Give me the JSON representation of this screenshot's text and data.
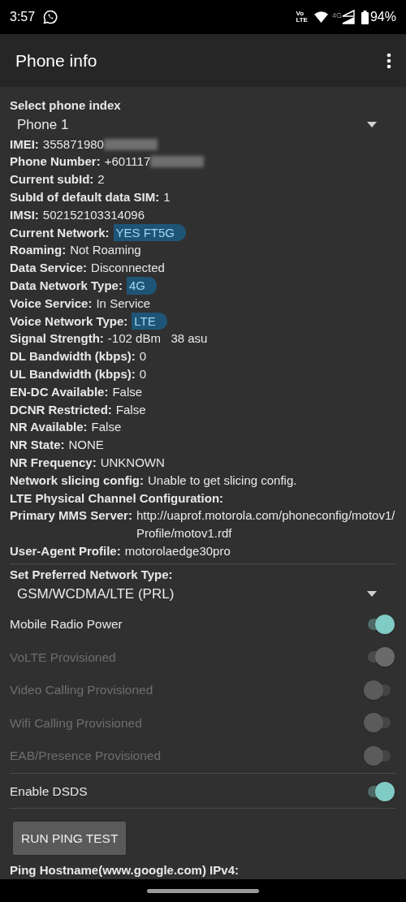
{
  "status_bar": {
    "time": "3:57",
    "volte_top": "Vo",
    "volte_bottom": "LTE",
    "data_type": "4G",
    "battery": "94%"
  },
  "app_bar": {
    "title": "Phone info"
  },
  "phone_index": {
    "label": "Select phone index",
    "value": "Phone 1"
  },
  "info_rows": [
    {
      "label": "IMEI:",
      "value": "355871980",
      "redacted": true,
      "highlighted": false
    },
    {
      "label": "Phone Number:",
      "value": "+601117",
      "redacted": true,
      "highlighted": false
    },
    {
      "label": "Current subId:",
      "value": "2",
      "redacted": false,
      "highlighted": false
    },
    {
      "label": "SubId of default data SIM:",
      "value": "1",
      "redacted": false,
      "highlighted": false
    },
    {
      "label": "IMSI:",
      "value": "502152103314096",
      "redacted": false,
      "highlighted": false
    },
    {
      "label": "Current Network:",
      "value": "YES FT5G",
      "redacted": false,
      "highlighted": true
    },
    {
      "label": "Roaming:",
      "value": "Not Roaming",
      "redacted": false,
      "highlighted": false
    },
    {
      "label": "Data Service:",
      "value": "Disconnected",
      "redacted": false,
      "highlighted": false
    },
    {
      "label": "Data Network Type:",
      "value": "4G",
      "redacted": false,
      "highlighted": true
    },
    {
      "label": "Voice Service:",
      "value": "In Service",
      "redacted": false,
      "highlighted": false
    },
    {
      "label": "Voice Network Type:",
      "value": "LTE",
      "redacted": false,
      "highlighted": true
    },
    {
      "label": "Signal Strength:",
      "value": "-102 dBm   38 asu",
      "redacted": false,
      "highlighted": false
    },
    {
      "label": "DL Bandwidth (kbps):",
      "value": "0",
      "redacted": false,
      "highlighted": false
    },
    {
      "label": "UL Bandwidth (kbps):",
      "value": "0",
      "redacted": false,
      "highlighted": false
    },
    {
      "label": "EN-DC Available:",
      "value": "False",
      "redacted": false,
      "highlighted": false
    },
    {
      "label": "DCNR Restricted:",
      "value": "False",
      "redacted": false,
      "highlighted": false
    },
    {
      "label": "NR Available:",
      "value": "False",
      "redacted": false,
      "highlighted": false
    },
    {
      "label": "NR State:",
      "value": "NONE",
      "redacted": false,
      "highlighted": false
    },
    {
      "label": "NR Frequency:",
      "value": "UNKNOWN",
      "redacted": false,
      "highlighted": false
    },
    {
      "label": "Network slicing config:",
      "value": "Unable to get slicing config.",
      "redacted": false,
      "highlighted": false
    },
    {
      "label": "LTE Physical Channel Configuration:"
    },
    {
      "label": "Primary MMS Server:",
      "value": "http://uaprof.motorola.com/phoneconfig/motov1/Profile/motov1.rdf",
      "redacted": false,
      "highlighted": false
    },
    {
      "label": "User-Agent Profile:",
      "value": "motorolaedge30pro",
      "redacted": false,
      "highlighted": false
    }
  ],
  "network_type": {
    "label": "Set Preferred Network Type:",
    "value": "GSM/WCDMA/LTE (PRL)"
  },
  "switches": [
    {
      "label": "Mobile Radio Power",
      "on": true,
      "disabled": false
    },
    {
      "label": "VoLTE Provisioned",
      "on": true,
      "disabled": true
    },
    {
      "label": "Video Calling Provisioned",
      "on": false,
      "disabled": true
    },
    {
      "label": "Wifi Calling Provisioned",
      "on": false,
      "disabled": true
    },
    {
      "label": "EAB/Presence Provisioned",
      "on": false,
      "disabled": true
    },
    {
      "label": "Enable DSDS",
      "on": true,
      "disabled": false,
      "divider_before": true
    }
  ],
  "ping_button": "RUN PING TEST",
  "ping_rows": [
    {
      "label": "Ping Hostname(www.google.com) IPv4:"
    }
  ]
}
